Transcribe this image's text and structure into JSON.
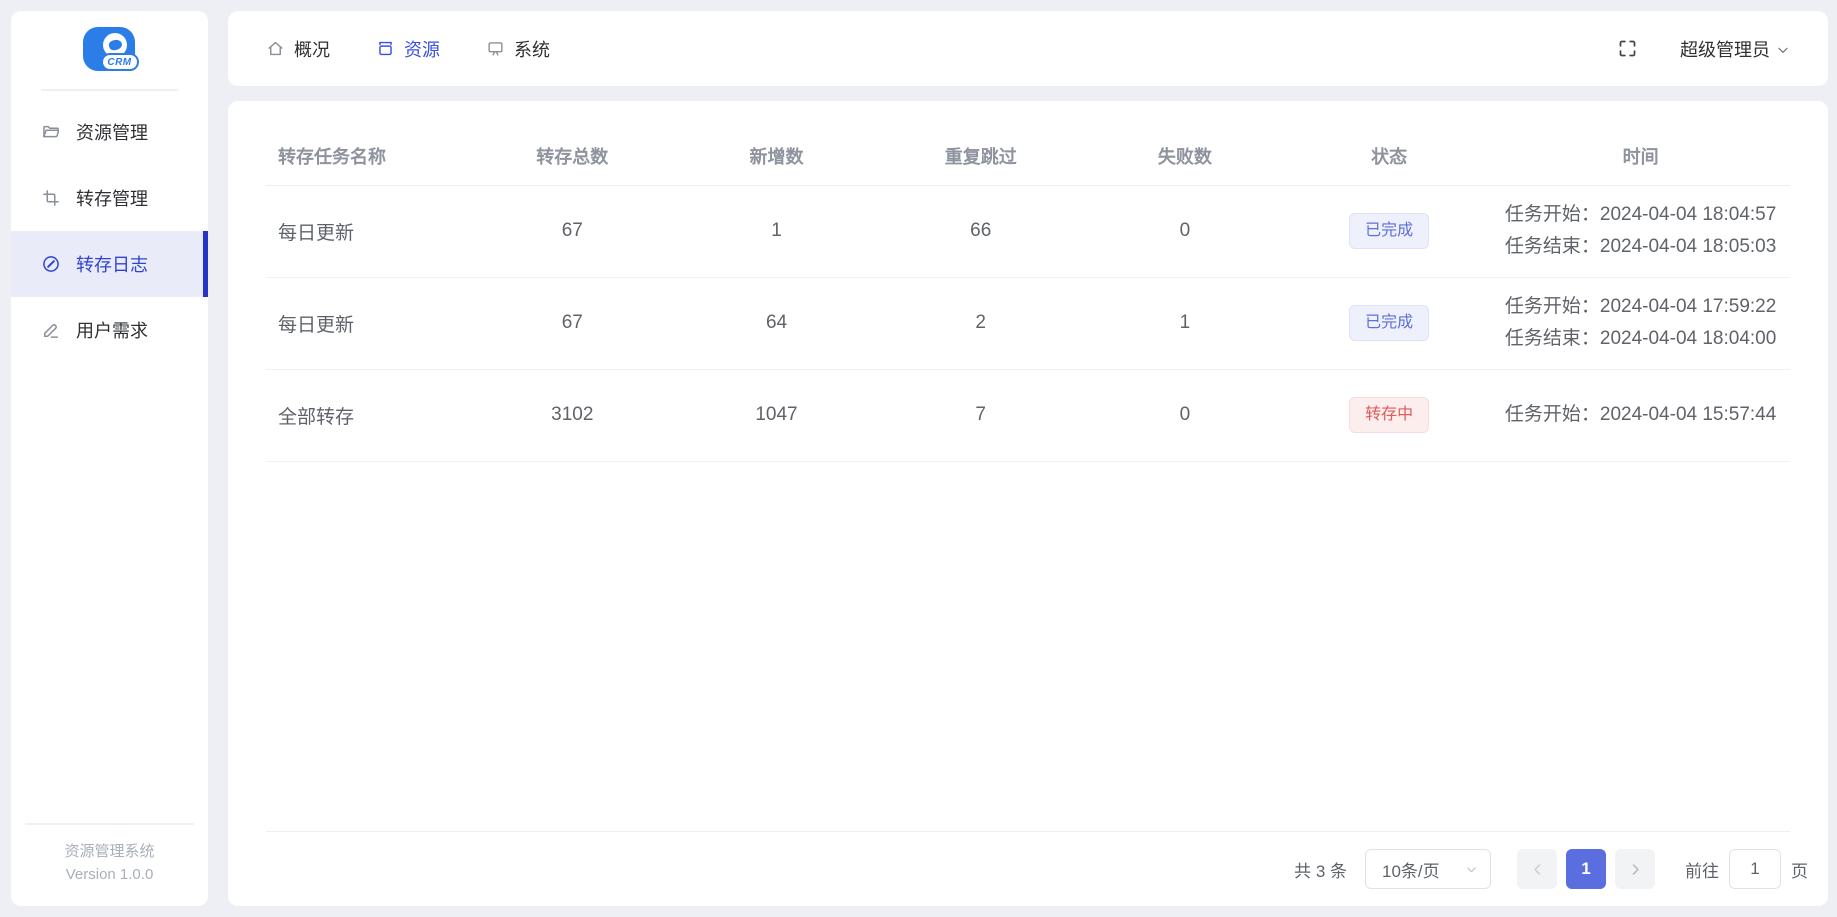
{
  "sidebar": {
    "logo_text": "CRM",
    "items": [
      {
        "label": "资源管理",
        "icon": "folder-icon"
      },
      {
        "label": "转存管理",
        "icon": "crop-icon"
      },
      {
        "label": "转存日志",
        "icon": "compass-icon",
        "active": true
      },
      {
        "label": "用户需求",
        "icon": "edit-icon"
      }
    ],
    "footer": {
      "line1": "资源管理系统",
      "line2": "Version 1.0.0"
    }
  },
  "topbar": {
    "tabs": [
      {
        "label": "概况",
        "icon": "home-icon"
      },
      {
        "label": "资源",
        "icon": "box-icon",
        "active": true
      },
      {
        "label": "系统",
        "icon": "monitor-icon"
      }
    ],
    "user_menu_label": "超级管理员"
  },
  "table": {
    "columns": [
      "转存任务名称",
      "转存总数",
      "新增数",
      "重复跳过",
      "失败数",
      "状态",
      "时间"
    ],
    "rows": [
      {
        "name": "每日更新",
        "total": "67",
        "added": "1",
        "skipped": "66",
        "failed": "0",
        "status": "已完成",
        "status_type": "done",
        "time_line1": "任务开始：2024-04-04 18:04:57",
        "time_line2": "任务结束：2024-04-04 18:05:03"
      },
      {
        "name": "每日更新",
        "total": "67",
        "added": "64",
        "skipped": "2",
        "failed": "1",
        "status": "已完成",
        "status_type": "done",
        "time_line1": "任务开始：2024-04-04 17:59:22",
        "time_line2": "任务结束：2024-04-04 18:04:00"
      },
      {
        "name": "全部转存",
        "total": "3102",
        "added": "1047",
        "skipped": "7",
        "failed": "0",
        "status": "转存中",
        "status_type": "running",
        "time_line1": "任务开始：2024-04-04 15:57:44"
      }
    ]
  },
  "pagination": {
    "total_label": "共 3 条",
    "page_size_label": "10条/页",
    "current_page": "1",
    "goto_label": "前往",
    "goto_value": "1",
    "goto_unit": "页"
  },
  "colors": {
    "primary": "#3a4fe0",
    "sidebar_active_bg": "#e9ecf8",
    "status_done_text": "#5e6fd9",
    "status_done_bg": "#eef1fc",
    "status_running_text": "#e05a5a",
    "status_running_bg": "#fdeeee",
    "active_page_bg": "#5a6ee0",
    "logo_blue": "#2b7de8"
  }
}
